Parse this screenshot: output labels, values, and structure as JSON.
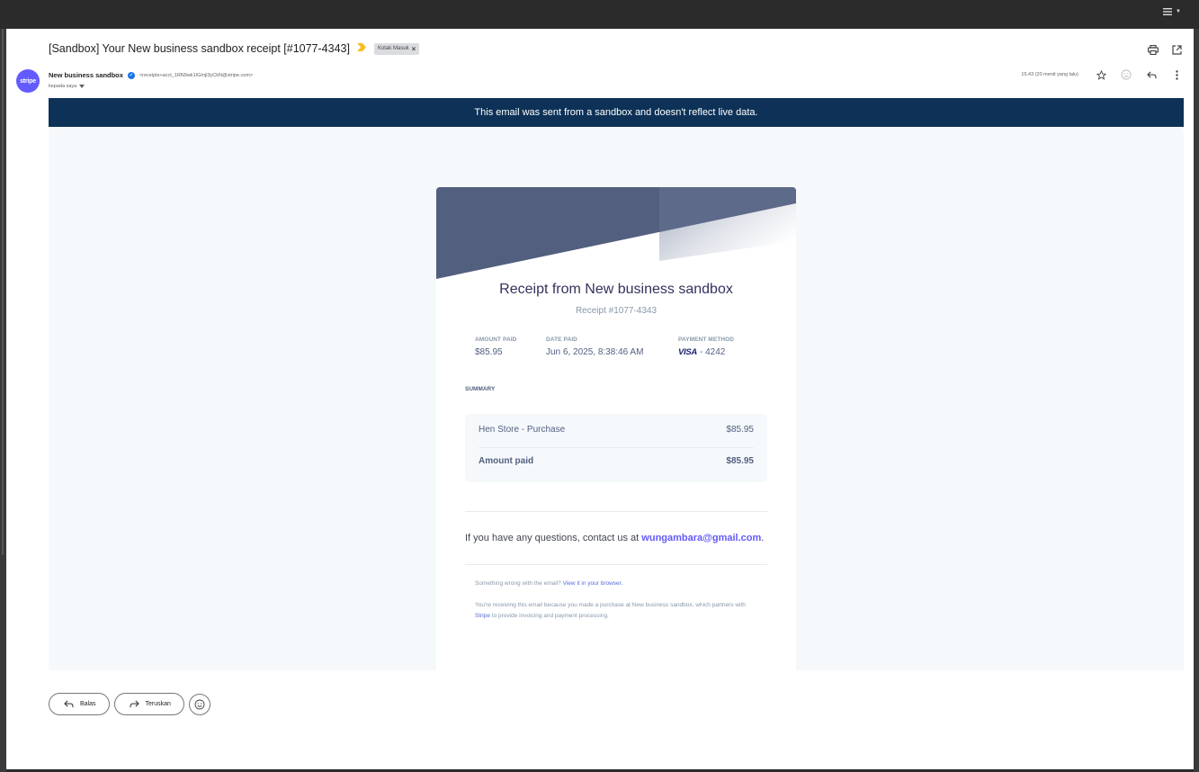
{
  "subject": "[Sandbox] Your New business sandbox receipt [#1077-4343]",
  "label_chip": "Kotak Masuk",
  "sender": {
    "avatar_text": "stripe",
    "name": "New business sandbox",
    "email": "<receipts+acct_1RN9wk1IGmjl3yCkN@stripe.com>",
    "to": "kepada saya"
  },
  "timestamp": "15.43 (20 menit yang lalu)",
  "banner": "This email was sent from a sandbox and doesn't reflect live data.",
  "receipt": {
    "title": "Receipt from New business sandbox",
    "number": "Receipt #1077-4343",
    "amount_paid_label": "AMOUNT PAID",
    "amount_paid_value": "$85.95",
    "date_paid_label": "DATE PAID",
    "date_paid_value": "Jun 6, 2025, 8:38:46 AM",
    "payment_method_label": "PAYMENT METHOD",
    "card_brand": "VISA",
    "card_last4": "- 4242",
    "summary_label": "SUMMARY",
    "line_item": "Hen Store - Purchase",
    "line_amount": "$85.95",
    "total_label": "Amount paid",
    "total_amount": "$85.95",
    "questions_prefix": "If you have any questions, contact us at ",
    "contact_email": "wungambara@gmail.com",
    "questions_suffix": ".",
    "wrong_prefix": "Something wrong with the email? ",
    "wrong_link": "View it in your browser.",
    "receiving_prefix": "You're receiving this email because you made a purchase at New business sandbox, which partners with ",
    "stripe_link": "Stripe",
    "receiving_suffix": " to provide invoicing and payment processing."
  },
  "actions": {
    "reply": "Balas",
    "forward": "Teruskan"
  },
  "colors": {
    "banner": "#0d3157",
    "stripe": "#635bff",
    "header_art": "#525f7f",
    "link": "#625afa"
  },
  "icons": [
    "menu-icon",
    "important-marker-icon",
    "print-icon",
    "open-in-new-icon",
    "verified-icon",
    "chevron-down-icon",
    "star-icon",
    "emoji-icon",
    "reply-icon",
    "more-vert-icon",
    "forward-icon"
  ]
}
